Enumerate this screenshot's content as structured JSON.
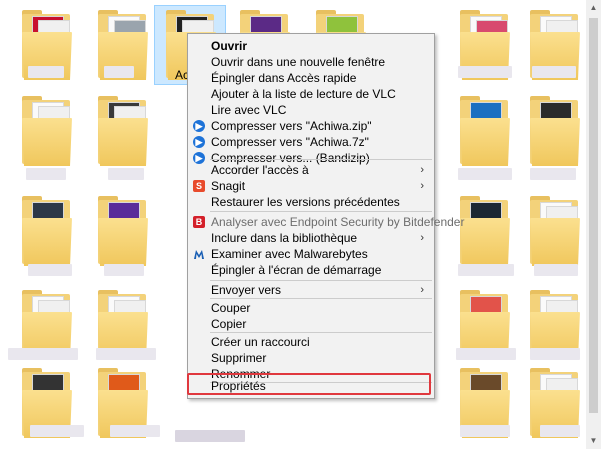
{
  "selected_item": {
    "label_visible": "Acl"
  },
  "context_menu": {
    "items": [
      {
        "label": "Ouvrir",
        "bold": true,
        "icon": "",
        "submenu": false,
        "disabled": false
      },
      {
        "label": "Ouvrir dans une nouvelle fenêtre",
        "icon": "",
        "submenu": false
      },
      {
        "label": "Épingler dans Accès rapide",
        "icon": "",
        "submenu": false
      },
      {
        "label": "Ajouter à la liste de lecture de VLC",
        "icon": "",
        "submenu": false
      },
      {
        "label": "Lire avec VLC",
        "icon": "",
        "submenu": false
      },
      {
        "label": "Compresser vers \"Achiwa.zip\"",
        "icon": "bandizip-icon",
        "submenu": false
      },
      {
        "label": "Compresser vers \"Achiwa.7z\"",
        "icon": "bandizip-icon",
        "submenu": false
      },
      {
        "label": "Compresser vers... (Bandizip)",
        "icon": "bandizip-icon",
        "submenu": false
      },
      {
        "label": "Accorder l'accès à",
        "icon": "",
        "submenu": true
      },
      {
        "label": "Snagit",
        "icon": "snagit-icon",
        "submenu": true
      },
      {
        "label": "Restaurer les versions précédentes",
        "icon": "",
        "submenu": false
      },
      {
        "label": "Analyser avec Endpoint Security by Bitdefender",
        "icon": "bitdefender-icon",
        "submenu": false,
        "disabled": true
      },
      {
        "label": "Inclure dans la bibliothèque",
        "icon": "",
        "submenu": true
      },
      {
        "label": "Examiner avec Malwarebytes",
        "icon": "malwarebytes-icon",
        "submenu": false
      },
      {
        "label": "Épingler à l'écran de démarrage",
        "icon": "",
        "submenu": false
      },
      {
        "label": "Envoyer vers",
        "icon": "",
        "submenu": true
      },
      {
        "label": "Couper",
        "icon": "",
        "submenu": false
      },
      {
        "label": "Copier",
        "icon": "",
        "submenu": false
      },
      {
        "label": "Créer un raccourci",
        "icon": "",
        "submenu": false
      },
      {
        "label": "Supprimer",
        "icon": "",
        "submenu": false
      },
      {
        "label": "Renommer",
        "icon": "",
        "submenu": false
      },
      {
        "label": "Propriétés",
        "icon": "",
        "submenu": false,
        "highlighted": true
      }
    ],
    "submenu_arrow": "›",
    "icon_glyphs": {
      "bandizip": "▶",
      "snagit": "S",
      "bitdefender": "B",
      "malwarebytes": "M"
    }
  },
  "colors": {
    "highlight_border": "#e0383e",
    "selection_bg": "#cce8ff",
    "menu_bg": "#f2f2f2",
    "folder_yellow": "#f3d27a"
  },
  "scrollbar": {
    "up_glyph": "▲",
    "down_glyph": "▼"
  }
}
